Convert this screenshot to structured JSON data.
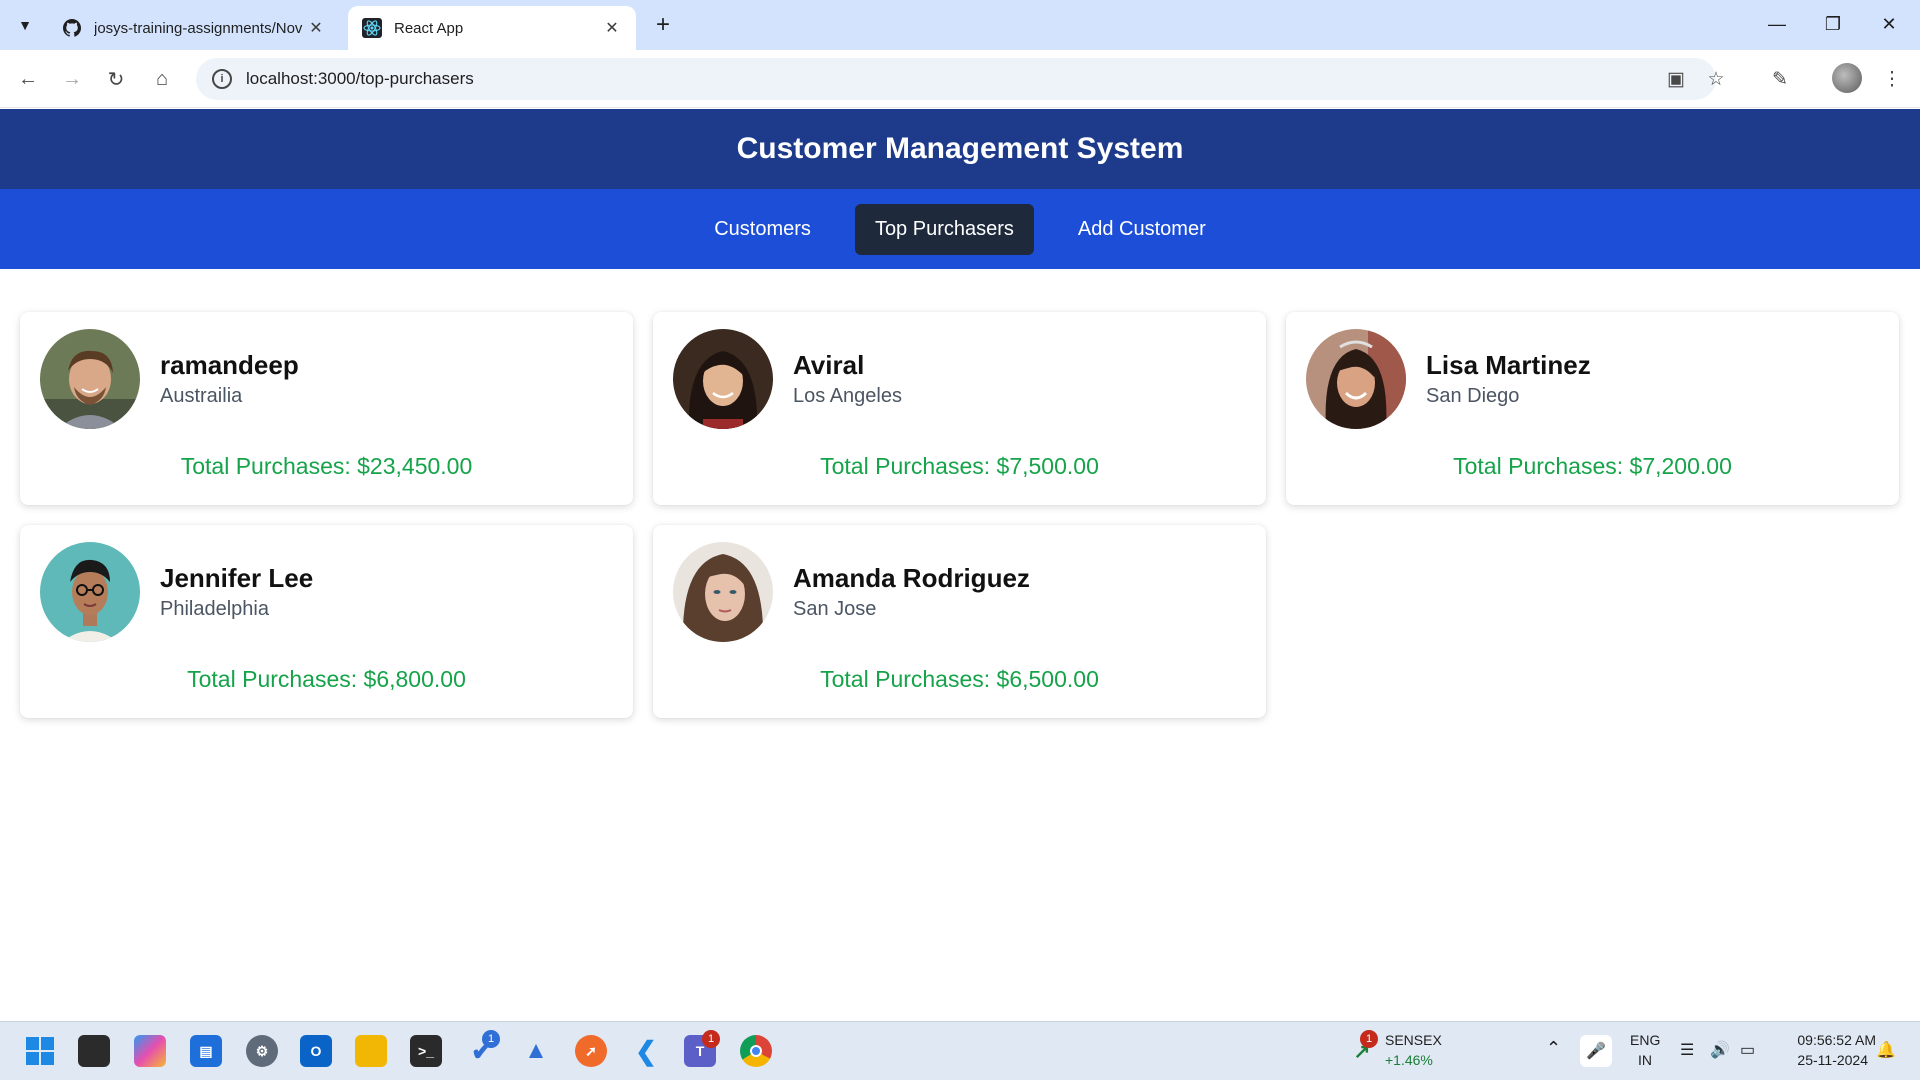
{
  "browser": {
    "tabs": [
      {
        "title": "josys-training-assignments/Nov",
        "icon": "github-icon"
      },
      {
        "title": "React App",
        "icon": "react-icon"
      }
    ],
    "url": "localhost:3000/top-purchasers"
  },
  "app": {
    "title": "Customer Management System",
    "nav": {
      "customers": "Customers",
      "top_purchasers": "Top Purchasers",
      "add_customer": "Add Customer",
      "active": "Top Purchasers"
    },
    "customers": [
      {
        "name": "ramandeep",
        "city": "Austrailia",
        "total": "Total Purchases: $23,450.00"
      },
      {
        "name": "Aviral",
        "city": "Los Angeles",
        "total": "Total Purchases: $7,500.00"
      },
      {
        "name": "Lisa Martinez",
        "city": "San Diego",
        "total": "Total Purchases: $7,200.00"
      },
      {
        "name": "Jennifer Lee",
        "city": "Philadelphia",
        "total": "Total Purchases: $6,800.00"
      },
      {
        "name": "Amanda Rodriguez",
        "city": "San Jose",
        "total": "Total Purchases: $6,500.00"
      }
    ]
  },
  "taskbar": {
    "sensex_label": "SENSEX",
    "sensex_change": "+1.46%",
    "sensex_badge": "1",
    "lang_top": "ENG",
    "lang_bottom": "IN",
    "time": "09:56:52 AM",
    "date": "25-11-2024",
    "todo_badge": "1",
    "teams_badge": "1"
  },
  "colors": {
    "header_bg": "#1e3a8a",
    "nav_bg": "#1d4ed8",
    "nav_active_bg": "#1e293b",
    "total_text": "#16a34a"
  }
}
